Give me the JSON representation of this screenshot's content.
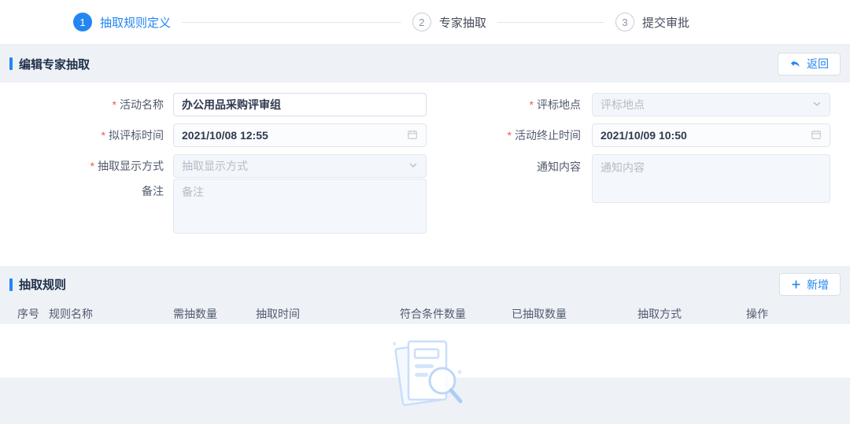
{
  "theme": {
    "accent": "#2386f1",
    "required_color": "#f2564d",
    "page_background": "#eef2f7",
    "empty_icon_blue": "#c9defa"
  },
  "ui": {
    "required_mark": "*"
  },
  "stepper": {
    "steps": [
      {
        "num": "1",
        "label": "抽取规则定义",
        "state": "active"
      },
      {
        "num": "2",
        "label": "专家抽取",
        "state": "pending"
      },
      {
        "num": "3",
        "label": "提交审批",
        "state": "pending"
      }
    ]
  },
  "edit_section": {
    "title": "编辑专家抽取",
    "back_label": "返回",
    "fields": {
      "activity_name": {
        "label": "活动名称",
        "required": true,
        "value": "办公用品采购评审组"
      },
      "eval_location": {
        "label": "评标地点",
        "required": true,
        "placeholder": "评标地点"
      },
      "planned_time": {
        "label": "拟评标时间",
        "required": true,
        "value": "2021/10/08 12:55"
      },
      "end_time": {
        "label": "活动终止时间",
        "required": true,
        "value": "2021/10/09 10:50"
      },
      "display_mode": {
        "label": "抽取显示方式",
        "required": true,
        "placeholder": "抽取显示方式"
      },
      "notice_content": {
        "label": "通知内容",
        "required": false,
        "placeholder": "通知内容"
      },
      "remark": {
        "label": "备注",
        "required": false,
        "placeholder": "备注"
      }
    }
  },
  "rules_section": {
    "title": "抽取规则",
    "add_label": "新增",
    "table": {
      "headers": [
        "序号",
        "规则名称",
        "需抽数量",
        "抽取时间",
        "符合条件数量",
        "已抽取数量",
        "抽取方式",
        "操作"
      ],
      "rows": [],
      "empty_icon": "document-search-icon"
    }
  }
}
